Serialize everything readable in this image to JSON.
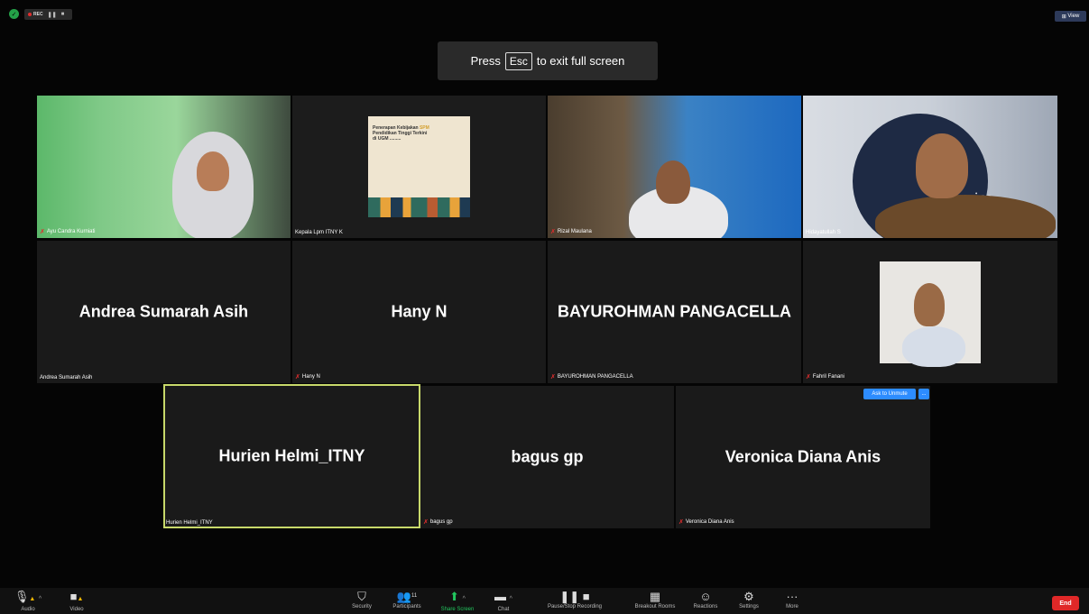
{
  "topbar": {
    "rec_label": "REC",
    "pause_icon": "pause-icon",
    "stop_icon": "stop-icon",
    "view_label": "View",
    "secure_color": "#24a148"
  },
  "toast": {
    "prefix": "Press",
    "key": "Esc",
    "suffix": "to exit full screen"
  },
  "participants": [
    {
      "name": "Ayu Candra Kurniati",
      "muted": true,
      "video": true
    },
    {
      "name": "Kepala Lpm ITNY K",
      "muted": false,
      "video": true
    },
    {
      "name": "Rizal Maulana",
      "muted": true,
      "video": true
    },
    {
      "name": "Hidayatullah S",
      "muted": false,
      "video": true
    },
    {
      "name": "Andrea Sumarah Asih",
      "muted": false,
      "video": false
    },
    {
      "name": "Hany N",
      "muted": true,
      "video": false
    },
    {
      "name": "BAYUROHMAN PANGACELLA",
      "muted": true,
      "video": false
    },
    {
      "name": "Fahril Fanani",
      "muted": true,
      "video": true
    },
    {
      "name": "Hurien Helmi_ITNY",
      "muted": false,
      "video": false,
      "active": true
    },
    {
      "name": "bagus gp",
      "muted": true,
      "video": false
    },
    {
      "name": "Veronica Diana Anis",
      "muted": true,
      "video": false
    }
  ],
  "slide": {
    "line1a": "Penerapan Kebijakan ",
    "line1b": "SPM",
    "line2": "Pendidikan Tinggi Terkini",
    "line3": "di UGM ........."
  },
  "wall_text": "ine",
  "ask_unmute": "Ask to Unmute",
  "ask_more": "...",
  "toolbar": {
    "audio": "Audio",
    "video": "Video",
    "security": "Security",
    "participants": "Participants",
    "participant_count": "11",
    "share": "Share Screen",
    "chat": "Chat",
    "pause_stop": "Pause/Stop Recording",
    "breakout": "Breakout Rooms",
    "reactions": "Reactions",
    "settings": "Settings",
    "more": "More",
    "end": "End",
    "accent_green": "#22c55e",
    "end_red": "#e02828"
  }
}
